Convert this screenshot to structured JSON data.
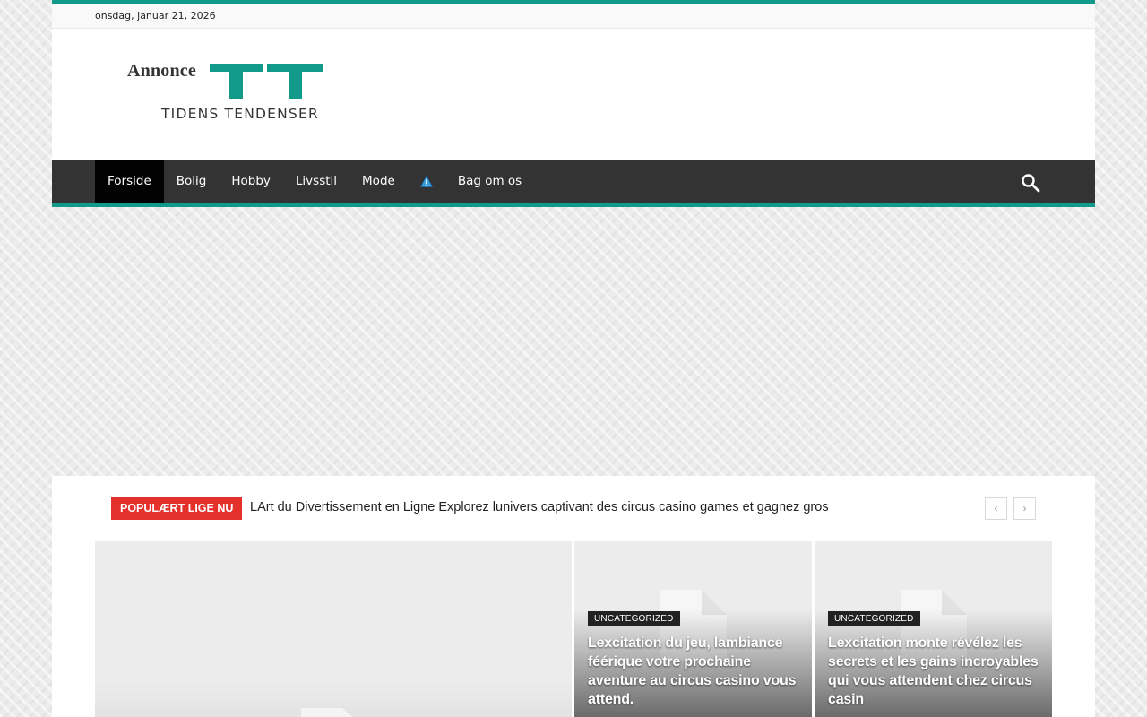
{
  "topbar": {
    "date": "onsdag, januar 21, 2026"
  },
  "logo": {
    "prefix": "Annonce",
    "mark": "TT",
    "tagline": "TIDENS TENDENSER"
  },
  "nav": {
    "items": [
      {
        "label": "Forside",
        "active": true
      },
      {
        "label": "Bolig"
      },
      {
        "label": "Hobby"
      },
      {
        "label": "Livsstil"
      },
      {
        "label": "Mode"
      },
      {
        "label": "",
        "icon": "warning-icon"
      },
      {
        "label": "Bag om os"
      }
    ],
    "search_icon": "search-icon"
  },
  "ticker": {
    "label": "POPULÆRT LIGE NU",
    "headline": "LArt du Divertissement en Ligne Explorez lunivers captivant des circus casino games et gagnez gros",
    "prev": "‹",
    "next": "›"
  },
  "featured": [
    {
      "category": "",
      "title": ""
    },
    {
      "category": "UNCATEGORIZED",
      "title": "Lexcitation du jeu, lambiance féérique votre prochaine aventure au circus casino vous attend."
    },
    {
      "category": "UNCATEGORIZED",
      "title": "Lexcitation monte révélez les secrets et les gains incroyables qui vous attendent chez circus casin"
    }
  ],
  "colors": {
    "accent": "#11998a",
    "nav_bg": "#333333",
    "ticker_label": "#e4312b"
  }
}
